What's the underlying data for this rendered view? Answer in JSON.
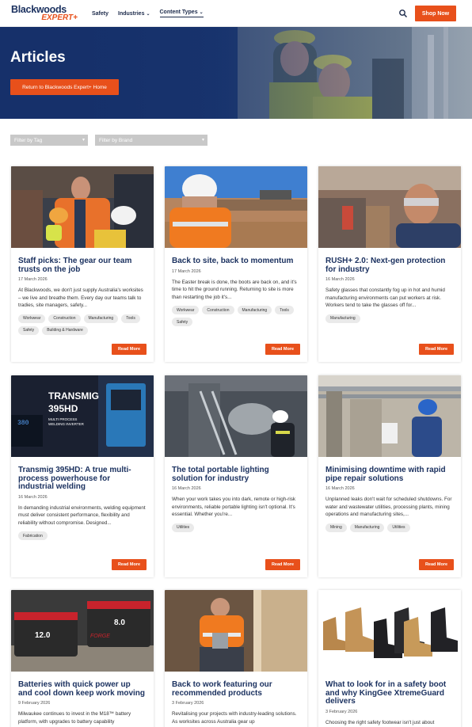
{
  "header": {
    "logo_line1": "Blackwoods",
    "logo_line2": "EXPERT+",
    "nav": [
      {
        "label": "Safety",
        "has_dropdown": false
      },
      {
        "label": "Industries",
        "has_dropdown": true
      },
      {
        "label": "Content Types",
        "has_dropdown": true
      }
    ],
    "search_icon": "search-icon",
    "shop_label": "Shop Now"
  },
  "hero": {
    "title": "Articles",
    "button_label": "Return to Blackwoods Expert+ Home"
  },
  "filters": {
    "tag_placeholder": "Filter by Tag",
    "brand_placeholder": "Filter by Brand"
  },
  "read_more_label": "Read More",
  "cards": [
    {
      "title": "Staff picks: The gear our team trusts on the job",
      "date": "17 March 2026",
      "desc": "At Blackwoods, we don't just supply Australia's worksites – we live and breathe them. Every day our teams talk to tradies, site managers, safety...",
      "tags": [
        "Workwear",
        "Construction",
        "Manufacturing",
        "Tools",
        "Safety",
        "Building & Hardware"
      ]
    },
    {
      "title": "Back to site, back to momentum",
      "date": "17 March 2026",
      "desc": "The Easter break is done, the boots are back on, and it's time to hit the ground running. Returning to site is more than restarting the job it's...",
      "tags": [
        "Workwear",
        "Construction",
        "Manufacturing",
        "Tools",
        "Safety"
      ]
    },
    {
      "title": "RUSH+ 2.0: Next-gen protection for industry",
      "date": "16 March 2026",
      "desc": "Safety glasses that constantly fog up in hot and humid manufacturing environments can put workers at risk. Workers tend to take the glasses off for...",
      "tags": [
        "Manufacturing"
      ]
    },
    {
      "title": "Transmig 395HD: A true multi-process powerhouse for industrial welding",
      "date": "16 March 2026",
      "desc": "In demanding industrial environments, welding equipment must deliver consistent performance, flexibility and reliability without compromise. Designed...",
      "tags": [
        "Fabrication"
      ],
      "img_text1": "TRANSMIG",
      "img_text2": "395HD",
      "img_text3": "MULTI PROCESS",
      "img_text4": "WELDING INVERTER",
      "img_text5": "380"
    },
    {
      "title": "The total portable lighting solution for industry",
      "date": "16 March 2026",
      "desc": "When your work takes you into dark, remote or high-risk environments, reliable portable lighting isn't optional. It's essential. Whether you're...",
      "tags": [
        "Utilities"
      ]
    },
    {
      "title": "Minimising downtime with rapid pipe repair solutions",
      "date": "16 March 2026",
      "desc": "Unplanned leaks don't wait for scheduled shutdowns. For water and wastewater utilities, processing plants, mining operations and manufacturing sites,...",
      "tags": [
        "Mining",
        "Manufacturing",
        "Utilities"
      ]
    },
    {
      "title": "Batteries with quick power up and cool down keep work moving",
      "date": "9 February 2026",
      "desc": "Milwaukee continues to invest in the M18™ battery platform, with upgrades to battery capability",
      "tags": [],
      "img_text1": "12.0",
      "img_text2": "8.0",
      "img_text3": "FORGE"
    },
    {
      "title": "Back to work featuring our recommended products",
      "date": "3 February 2026",
      "desc": "Revitalising your projects with industry-leading solutions. As worksites across Australia gear up",
      "tags": []
    },
    {
      "title": "What to look for in a safety boot and why KingGee XtremeGuard delivers",
      "date": "3 February 2026",
      "desc": "Choosing the right safety footwear isn't just about",
      "tags": []
    }
  ],
  "colors": {
    "accent": "#e8501b",
    "navy": "#1c3260",
    "hero": "#16306a"
  }
}
